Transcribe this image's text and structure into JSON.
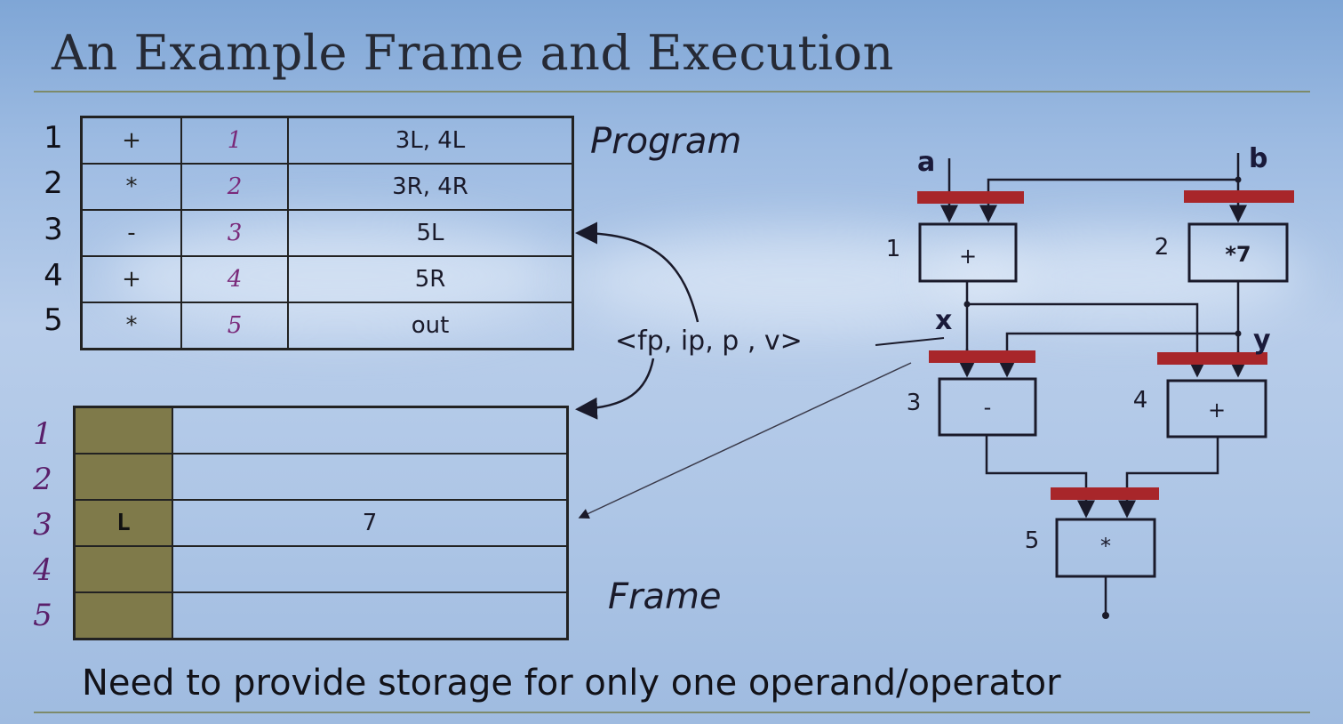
{
  "title": "An Example Frame and Execution",
  "program": {
    "label": "Program",
    "row_numbers": [
      "1",
      "2",
      "3",
      "4",
      "5"
    ],
    "rows": [
      {
        "op": "+",
        "index": "1",
        "dest": "3L, 4L"
      },
      {
        "op": "*",
        "index": "2",
        "dest": "3R, 4R"
      },
      {
        "op": "-",
        "index": "3",
        "dest": "5L"
      },
      {
        "op": "+",
        "index": "4",
        "dest": "5R"
      },
      {
        "op": "*",
        "index": "5",
        "dest": "out"
      }
    ]
  },
  "frame": {
    "label": "Frame",
    "row_numbers": [
      "1",
      "2",
      "3",
      "4",
      "5"
    ],
    "rows": [
      {
        "port": "",
        "value": ""
      },
      {
        "port": "",
        "value": ""
      },
      {
        "port": "L",
        "value": "7"
      },
      {
        "port": "",
        "value": ""
      },
      {
        "port": "",
        "value": ""
      }
    ]
  },
  "tuple": "<fp, ip, p , v>",
  "graph": {
    "inputs": {
      "a": "a",
      "b": "b"
    },
    "wires": {
      "x": "x",
      "y": "y"
    },
    "nodes": [
      {
        "num": "1",
        "op": "+"
      },
      {
        "num": "2",
        "op": "*7"
      },
      {
        "num": "3",
        "op": "-"
      },
      {
        "num": "4",
        "op": "+"
      },
      {
        "num": "5",
        "op": "*"
      }
    ]
  },
  "footer": "Need to provide storage for only one operand/operator",
  "colors": {
    "sync_bar": "#a8262a",
    "frame_port": "#7f7a4a",
    "index_text": "#7a2a7a"
  }
}
